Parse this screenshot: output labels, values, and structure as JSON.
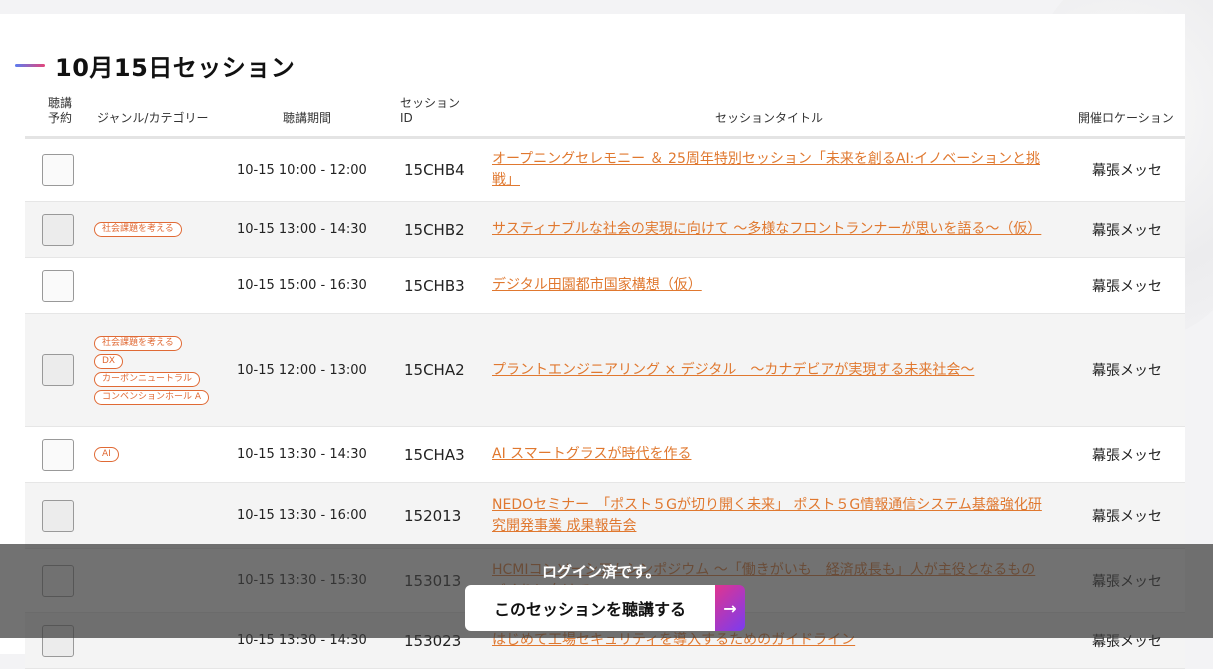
{
  "section_title": "10月15日セッション",
  "columns": {
    "reserve": "聴講\n予約",
    "genre": "ジャンル/カテゴリー",
    "period": "聴講期間",
    "session_id": "セッション\nID",
    "session_title": "セッションタイトル",
    "location": "開催ロケーション"
  },
  "rows": [
    {
      "tags": [],
      "period": "10-15 10:00 - 12:00",
      "id": "15CHB4",
      "title": "オープニングセレモニー ＆ 25周年特別セッション「未来を創るAI:イノベーションと挑戦」",
      "location": "幕張メッセ"
    },
    {
      "tags": [
        "社会課題を考える"
      ],
      "period": "10-15 13:00 - 14:30",
      "id": "15CHB2",
      "title": "サスティナブルな社会の実現に向けて ～多様なフロントランナーが思いを語る～（仮）",
      "location": "幕張メッセ"
    },
    {
      "tags": [],
      "period": "10-15 15:00 - 16:30",
      "id": "15CHB3",
      "title": "デジタル田園都市国家構想（仮）",
      "location": "幕張メッセ"
    },
    {
      "tags": [
        "社会課題を考える",
        "DX",
        "カーボンニュートラル",
        "コンベンションホール A"
      ],
      "period": "10-15 12:00 - 13:00",
      "id": "15CHA2",
      "title": "プラントエンジニアリング × デジタル　～カナデビアが実現する未来社会～",
      "location": "幕張メッセ"
    },
    {
      "tags": [
        "AI"
      ],
      "period": "10-15 13:30 - 14:30",
      "id": "15CHA3",
      "title": "AI スマートグラスが時代を作る",
      "location": "幕張メッセ"
    },
    {
      "tags": [],
      "period": "10-15 13:30 - 16:00",
      "id": "152013",
      "title": "NEDOセミナー　「ポスト５Gが切り開く未来」 ポスト５G情報通信システム基盤強化研究開発事業 成果報告会",
      "location": "幕張メッセ"
    },
    {
      "tags": [],
      "period": "10-15 13:30 - 15:30",
      "id": "153013",
      "title": "HCMIコンソーシアムシンポジウム ～「働きがいも　経済成長も」人が主役となるものづくりに向けて～",
      "location": "幕張メッセ"
    },
    {
      "tags": [],
      "period": "10-15 13:30 - 14:30",
      "id": "153023",
      "title": "はじめて工場セキュリティを導入するためのガイドライン",
      "location": "幕張メッセ"
    }
  ],
  "overlay": {
    "status": "ログイン済です。",
    "cta_label": "このセッションを聴講する",
    "cta_arrow": "→"
  },
  "colors": {
    "link": "#e0782f",
    "tag": "#e06a35",
    "title_bar_start": "#5b7cf0",
    "title_bar_end": "#e4457a"
  }
}
